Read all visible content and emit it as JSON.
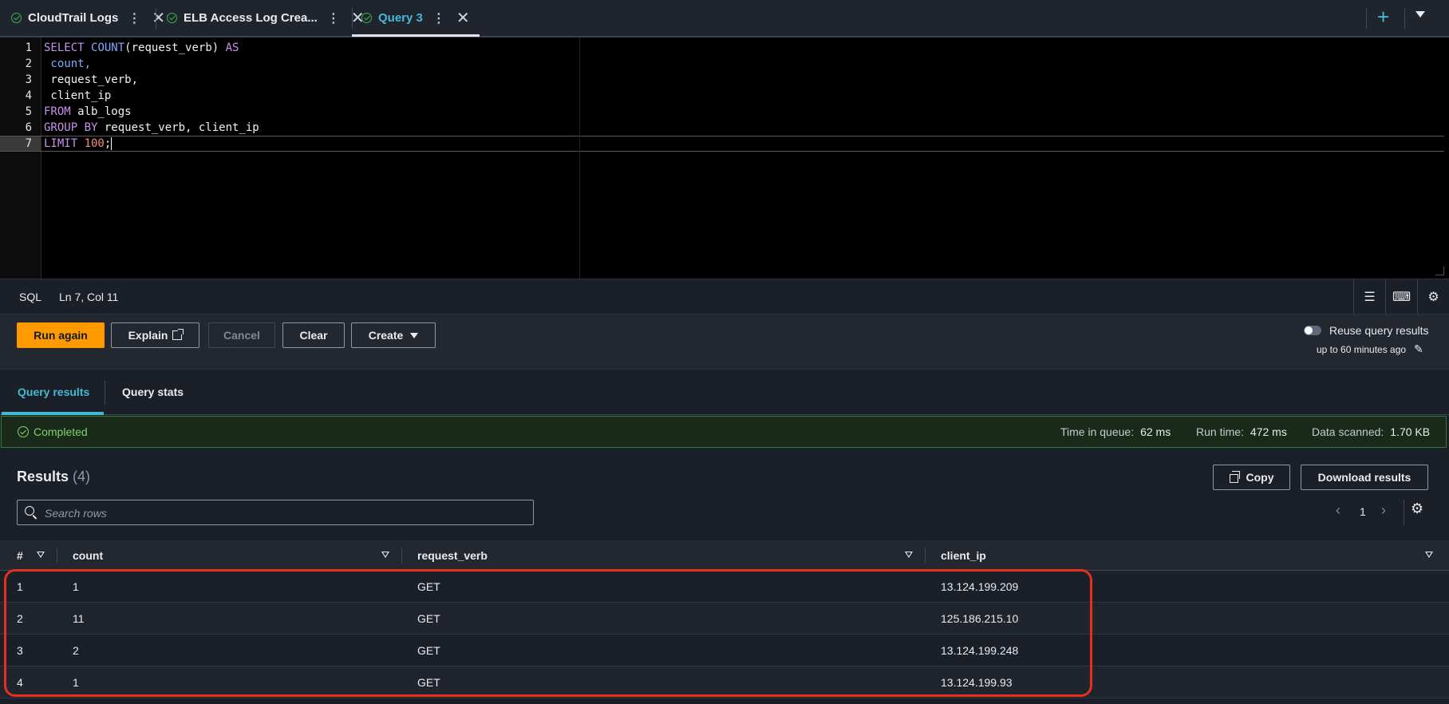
{
  "tabs": [
    {
      "label": "CloudTrail Logs",
      "active": false
    },
    {
      "label": "ELB Access Log Crea...",
      "active": false
    },
    {
      "label": "Query 3",
      "active": true
    }
  ],
  "editor": {
    "lines": [
      "1",
      "2",
      "3",
      "4",
      "5",
      "6",
      "7"
    ],
    "code": {
      "l1_kw1": "SELECT ",
      "l1_fn": "COUNT",
      "l1_rest": "(request_verb) ",
      "l1_kw2": "AS",
      "l2": " count,",
      "l3": " request_verb,",
      "l4": " client_ip",
      "l5_kw": "FROM",
      "l5_rest": " alb_logs",
      "l6_kw": "GROUP BY",
      "l6_rest": " request_verb, client_ip",
      "l7_kw": "LIMIT ",
      "l7_num": "100",
      "l7_rest": ";"
    }
  },
  "statusbar": {
    "language": "SQL",
    "cursor": "Ln 7, Col 11"
  },
  "toolbar": {
    "run_again": "Run again",
    "explain": "Explain",
    "cancel": "Cancel",
    "clear": "Clear",
    "create": "Create",
    "reuse_label": "Reuse query results",
    "reuse_sub": "up to 60 minutes ago",
    "reuse_enabled": false
  },
  "result_tabs": [
    "Query results",
    "Query stats"
  ],
  "banner": {
    "status": "Completed",
    "time_in_queue_label": "Time in queue:",
    "time_in_queue": "62 ms",
    "run_time_label": "Run time:",
    "run_time": "472 ms",
    "data_scanned_label": "Data scanned:",
    "data_scanned": "1.70 KB"
  },
  "results": {
    "title": "Results",
    "count": "(4)",
    "copy": "Copy",
    "download": "Download results",
    "search_placeholder": "Search rows",
    "page": "1",
    "columns": [
      "#",
      "count",
      "request_verb",
      "client_ip"
    ],
    "rows": [
      [
        "1",
        "1",
        "GET",
        "13.124.199.209"
      ],
      [
        "2",
        "11",
        "GET",
        "125.186.215.10"
      ],
      [
        "3",
        "2",
        "GET",
        "13.124.199.248"
      ],
      [
        "4",
        "1",
        "GET",
        "13.124.199.93"
      ]
    ]
  },
  "colors": {
    "accent": "#44b9d6",
    "primary_button": "#ff9900",
    "success": "#7ed36c",
    "highlight_box": "#e5301f"
  }
}
